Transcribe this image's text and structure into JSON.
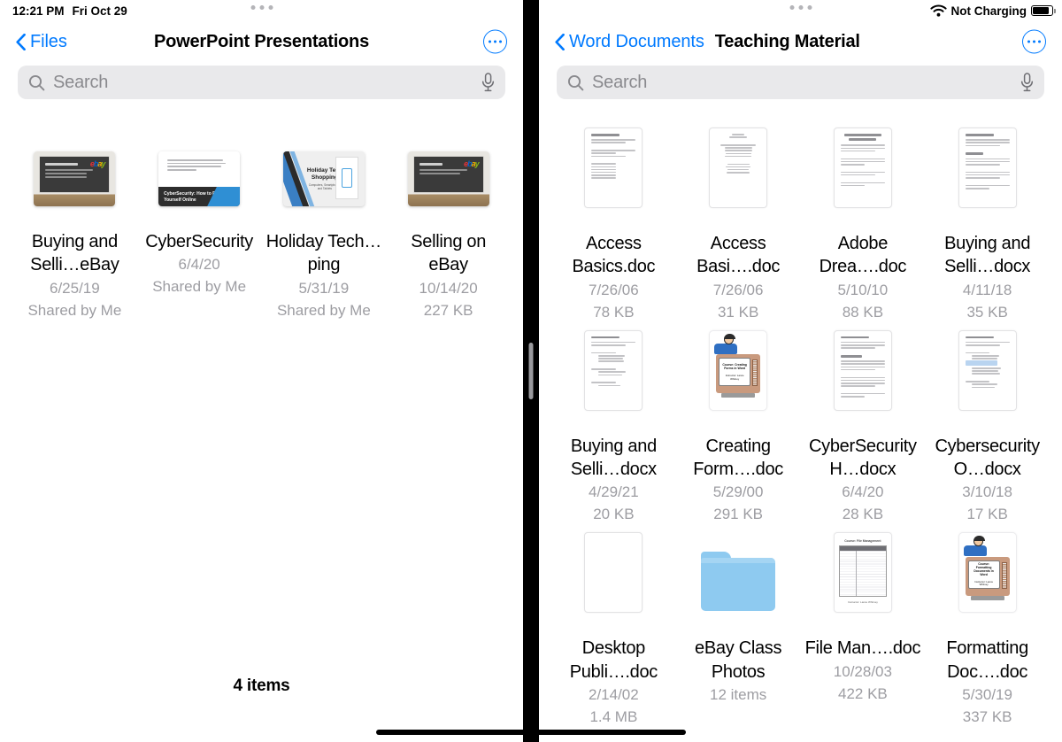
{
  "status_bar": {
    "time": "12:21 PM",
    "date": "Fri Oct 29",
    "battery_label": "Not Charging",
    "wifi_icon": "wifi-icon",
    "battery_icon": "battery-icon"
  },
  "colors": {
    "accent": "#007aff",
    "search_bg": "#e9e9eb",
    "meta_text": "#9d9da2",
    "folder_blue": "#8ecaf0",
    "divider": "#000000"
  },
  "left_pane": {
    "back_label": "Files",
    "title": "PowerPoint Presentations",
    "more_icon": "ellipsis-circle-icon",
    "search": {
      "placeholder": "Search",
      "search_icon": "search-icon",
      "mic_icon": "microphone-icon"
    },
    "item_count": "4 items",
    "files": [
      {
        "name": "Buying and Selli…eBay",
        "date": "6/25/19",
        "meta": "Shared by Me",
        "kind": "presentation",
        "thumb": "slide-ebay-buying"
      },
      {
        "name": "CyberSecurity",
        "date": "6/4/20",
        "meta": "Shared by Me",
        "kind": "presentation",
        "thumb": "slide-cybersecurity"
      },
      {
        "name": "Holiday Tech…ping",
        "date": "5/31/19",
        "meta": "Shared by Me",
        "kind": "presentation",
        "thumb": "slide-holiday-tech"
      },
      {
        "name": "Selling on eBay",
        "date": "10/14/20",
        "meta": "227 KB",
        "kind": "presentation",
        "thumb": "slide-ebay-selling"
      }
    ]
  },
  "right_pane": {
    "back_label": "Word Documents",
    "title": "Teaching Material",
    "more_icon": "ellipsis-circle-icon",
    "search": {
      "placeholder": "Search",
      "search_icon": "search-icon",
      "mic_icon": "microphone-icon"
    },
    "files": [
      {
        "name": "Access Basics.doc",
        "date": "7/26/06",
        "meta": "78 KB",
        "kind": "document",
        "thumb": "doc-page"
      },
      {
        "name": "Access Basi….doc",
        "date": "7/26/06",
        "meta": "31 KB",
        "kind": "document",
        "thumb": "doc-page-centered"
      },
      {
        "name": "Adobe Drea….doc",
        "date": "5/10/10",
        "meta": "88 KB",
        "kind": "document",
        "thumb": "doc-page-title"
      },
      {
        "name": "Buying and Selli…docx",
        "date": "4/11/18",
        "meta": "35 KB",
        "kind": "document",
        "thumb": "doc-page-paragraphs"
      },
      {
        "name": "Buying and Selli…docx",
        "date": "4/29/21",
        "meta": "20 KB",
        "kind": "document",
        "thumb": "doc-page-outline"
      },
      {
        "name": "Creating Form….doc",
        "date": "5/29/00",
        "meta": "291 KB",
        "kind": "course",
        "thumb": "tv-course-creating-forms"
      },
      {
        "name": "CyberSecurity H…docx",
        "date": "6/4/20",
        "meta": "28 KB",
        "kind": "document",
        "thumb": "doc-page-dense"
      },
      {
        "name": "Cybersecurity O…docx",
        "date": "3/10/18",
        "meta": "17 KB",
        "kind": "document",
        "thumb": "doc-page-highlight"
      },
      {
        "name": "Desktop Publi….doc",
        "date": "2/14/02",
        "meta": "1.4 MB",
        "kind": "document",
        "thumb": "doc-page-blank"
      },
      {
        "name": "eBay Class Photos",
        "date": "",
        "meta": "12 items",
        "kind": "folder",
        "thumb": "folder-icon"
      },
      {
        "name": "File Man….doc",
        "date": "10/28/03",
        "meta": "422 KB",
        "kind": "spreadsheet",
        "thumb": "sheet-file-management"
      },
      {
        "name": "Formatting Doc….doc",
        "date": "5/30/19",
        "meta": "337 KB",
        "kind": "course",
        "thumb": "tv-course-formatting"
      }
    ]
  },
  "thumb_text": {
    "ebay_buying_title": "BUYING AND SELLING ON EBAY",
    "ebay_selling_title": "SELLING ON EBAY",
    "cyber_band": "CyberSecurity: How to Protect Yourself Online",
    "holiday_title": "Holiday Tech Shopping",
    "holiday_sub": "Computers, Smartphones and Tablets",
    "course_creating_title": "Course: Creating Forms in Word",
    "course_creating_instructor": "Instructor: Lance Whitney",
    "course_formatting_title": "Course: Formatting Documents in Word",
    "course_formatting_instructor": "Instructor: Lance Whitney",
    "sheet_caption_top": "Course: File Management",
    "sheet_caption_bottom": "Instructor: Lance Whitney",
    "ebay_logo_letters": [
      "e",
      "b",
      "a",
      "y"
    ]
  },
  "divider": {
    "handle_name": "split-view-drag-handle"
  },
  "home_indicator": "home-indicator"
}
